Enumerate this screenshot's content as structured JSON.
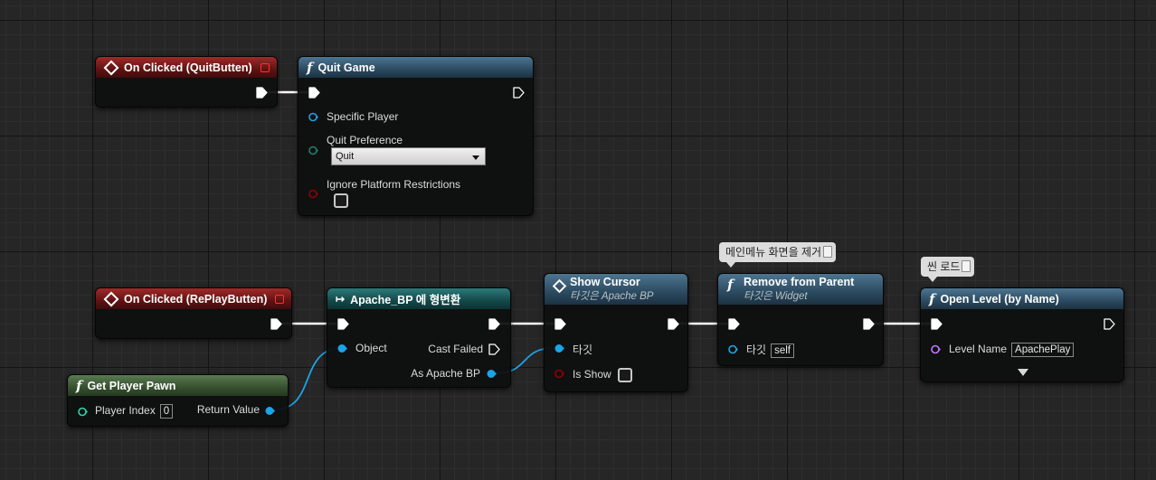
{
  "colors": {
    "exec": "#ffffff",
    "object_pin": "#1ca4e8",
    "struct_pin": "#26b3a4",
    "enum_pin": "#1e7f73",
    "bool_pin": "#950000",
    "name_pin": "#c677ff",
    "int_pin": "#22d9a9"
  },
  "nodes": {
    "quit_event": {
      "title": "On Clicked (QuitButten)"
    },
    "quit_game": {
      "title": "Quit Game",
      "pin_specific_player": "Specific Player",
      "pin_quit_preference": "Quit Preference",
      "quit_preference_value": "Quit",
      "pin_ignore_platform": "Ignore Platform Restrictions",
      "ignore_platform_checked": false
    },
    "replay_event": {
      "title": "On Clicked (RePlayButten)"
    },
    "cast": {
      "title": "Apache_BP 에 형변환",
      "pin_object": "Object",
      "pin_cast_failed": "Cast Failed",
      "pin_as_apache": "As Apache BP"
    },
    "show_cursor": {
      "title": "Show Cursor",
      "subtitle": "타깃은 Apache BP",
      "pin_target": "타깃",
      "pin_is_show": "Is Show",
      "is_show_checked": false
    },
    "remove_parent": {
      "title": "Remove from Parent",
      "subtitle": "타깃은 Widget",
      "pin_target": "타깃",
      "target_value": "self",
      "comment": "메인메뉴 화면을 제거"
    },
    "open_level": {
      "title": "Open Level (by Name)",
      "pin_level_name": "Level Name",
      "level_name_value": "ApachePlay",
      "comment": "씬 로드"
    },
    "get_player_pawn": {
      "title": "Get Player Pawn",
      "pin_player_index": "Player Index",
      "player_index_value": "0",
      "pin_return_value": "Return Value"
    }
  }
}
